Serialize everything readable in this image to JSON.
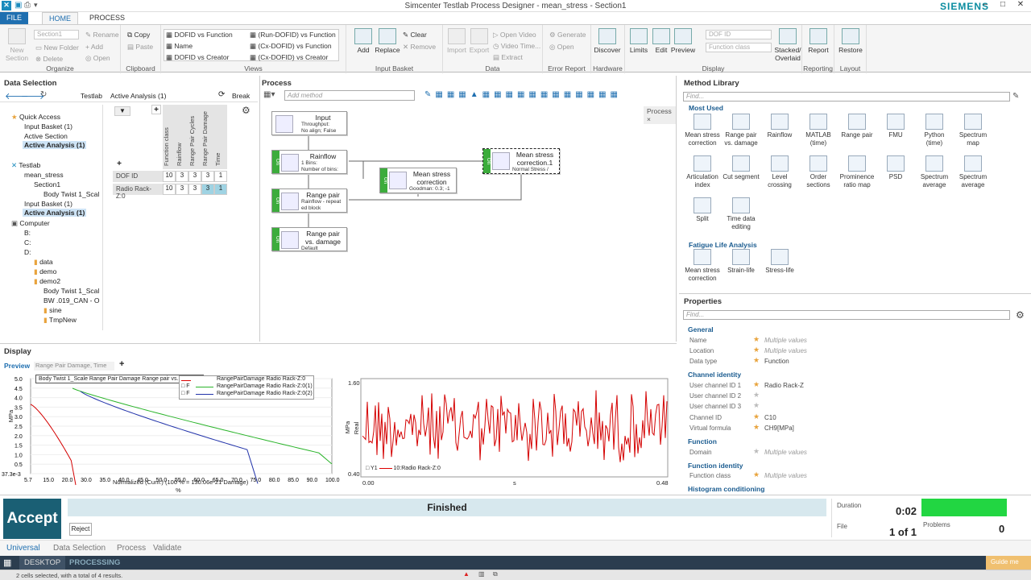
{
  "app": {
    "title": "Simcenter Testlab Process Designer - mean_stress - Section1",
    "brand": "SIEMENS"
  },
  "ribbon_tabs": [
    "FILE",
    "HOME",
    "PROCESS"
  ],
  "ribbon": {
    "organize": {
      "label": "Organize",
      "new_section": "New Section",
      "section_select": "Section1",
      "rename": "Rename",
      "new_folder": "New Folder",
      "delete": "Delete",
      "add": "Add",
      "open": "Open"
    },
    "clipboard": {
      "label": "Clipboard",
      "copy": "Copy",
      "paste": "Paste"
    },
    "views": {
      "label": "Views",
      "left": [
        "DOFID vs Function",
        "Name",
        "DOFID vs Creator"
      ],
      "right": [
        "(Run-DOFID) vs Function",
        "(Cx-DOFID) vs Function",
        "(Cx-DOFID) vs Creator"
      ]
    },
    "input_basket": {
      "label": "Input Basket",
      "add": "Add",
      "replace": "Replace",
      "clear": "Clear",
      "remove": "Remove"
    },
    "data": {
      "label": "Data",
      "import": "Import",
      "export": "Export",
      "open_video": "Open Video",
      "video_time": "Video Time...",
      "extract": "Extract"
    },
    "error_report": {
      "label": "Error Report",
      "generate": "Generate",
      "open": "Open"
    },
    "hardware": {
      "label": "Hardware",
      "discover": "Discover"
    },
    "display": {
      "label": "Display",
      "limits": "Limits",
      "edit": "Edit",
      "preview": "Preview",
      "dof_id": "DOF ID",
      "function_class": "Function class",
      "stacked": "Stacked/ Overlaid"
    },
    "reporting": {
      "label": "Reporting",
      "report": "Report"
    },
    "layout": {
      "label": "Layout",
      "restore": "Restore"
    }
  },
  "data_selection": {
    "title": "Data Selection",
    "breadcrumb": [
      "Testlab",
      "Active Analysis (1)"
    ],
    "break_label": "Break",
    "tree": [
      "Quick Access",
      "Input Basket (1)",
      "Active Section",
      "Active Analysis (1)",
      "Testlab",
      "mean_stress",
      "Section1",
      "Body Twist 1_Scal",
      "Input Basket (1)",
      "Active Analysis (1)",
      "Computer",
      "B:",
      "C:",
      "D:",
      "data",
      "demo",
      "demo2",
      "Body Twist 1_Scal",
      "BW .019_CAN - O",
      "sine",
      "TmpNew"
    ],
    "columns": [
      "Function class",
      "Rainflow",
      "Range Pair Cycles",
      "Range Pair Damage",
      "Time"
    ],
    "rows": [
      {
        "label": "DOF ID",
        "values": [
          "10",
          "3",
          "3",
          "3",
          "1"
        ]
      },
      {
        "label": "Radio Rack-Z:0",
        "values": [
          "10",
          "3",
          "3",
          "3",
          "1"
        ]
      }
    ]
  },
  "process": {
    "title": "Process",
    "add_method_placeholder": "Add method",
    "tab": "Process",
    "nodes": {
      "input": {
        "title": "Input",
        "sub": [
          "Throughput:",
          "No align; False"
        ]
      },
      "rainflow": {
        "title": "Rainflow",
        "sub": [
          "1 Bins:",
          "Number of bins:"
        ]
      },
      "mean": {
        "title": "Mean stress correction",
        "sub": [
          "Goodman: 0.3; -1"
        ]
      },
      "mean1": {
        "title": "Mean stress correction.1",
        "sub": [
          "Normal Stress /"
        ]
      },
      "rangepair": {
        "title": "Range pair",
        "sub": [
          "Rainflow - repeat",
          "ed block"
        ]
      },
      "rpd": {
        "title": "Range pair vs. damage",
        "sub": [
          "Default"
        ]
      }
    }
  },
  "method_library": {
    "title": "Method Library",
    "find_placeholder": "Find...",
    "most_used_label": "Most Used",
    "most_used": [
      "Mean stress correction",
      "Range pair vs. damage",
      "Rainflow",
      "MATLAB (time)",
      "Range pair",
      "FMU",
      "Python (time)",
      "Spectrum map",
      "Articulation index",
      "Cut segment",
      "Level crossing",
      "Order sections",
      "Prominence ratio map",
      "PSD",
      "Spectrum average",
      "Spectrum average",
      "Split",
      "Time data editing"
    ],
    "fatigue_label": "Fatigue Life Analysis",
    "fatigue": [
      "Mean stress correction",
      "Strain-life",
      "Stress-life"
    ]
  },
  "properties": {
    "title": "Properties",
    "find_placeholder": "Find...",
    "general": {
      "label": "General",
      "name_label": "Name",
      "name_val": "Multiple values",
      "location_label": "Location",
      "location_val": "Multiple values",
      "dtype_label": "Data type",
      "dtype_val": "Function"
    },
    "channel": {
      "label": "Channel identity",
      "uc1_label": "User channel ID 1",
      "uc1_val": "Radio Rack-Z",
      "uc2_label": "User channel ID 2",
      "uc3_label": "User channel ID 3",
      "cid_label": "Channel ID",
      "cid_val": "C10",
      "vf_label": "Virtual formula",
      "vf_val": "CH9[MPa]"
    },
    "function": {
      "label": "Function",
      "domain_label": "Domain",
      "domain_val": "Multiple values"
    },
    "function_identity": {
      "label": "Function identity",
      "fc_label": "Function class",
      "fc_val": "Multiple values"
    },
    "histogram_label": "Histogram conditioning"
  },
  "display": {
    "title": "Display",
    "preview_tab": "Preview",
    "dropdown": "Range Pair Damage, Time",
    "left_tooltip": "Body Twist 1_Scale  Range Pair Damage  Range pair vs. damage",
    "left_legend": [
      "RangePairDamage Radio Rack-Z:0",
      "RangePairDamage Radio Rack-Z:0(1)",
      "RangePairDamage Radio Rack-Z:0(2)"
    ],
    "left_legend_marks": [
      "F",
      "F"
    ],
    "left_ylabel": "MPa",
    "left_yticks": [
      "5.0",
      "4.5",
      "4.0",
      "3.5",
      "3.0",
      "2.5",
      "2.0",
      "1.5",
      "1.0",
      "0.5",
      "37.3e-3"
    ],
    "left_xticks": [
      "5.7",
      "15.0",
      "20.0",
      "30.0",
      "35.0",
      "40.0",
      "45.0",
      "50.0",
      "55.0",
      "60.0",
      "65.0",
      "70.0",
      "75.0",
      "80.0",
      "85.0",
      "90.0",
      "100.0"
    ],
    "left_xlabel": "Normalized (Cum.) (100 % = 130.06e-21 Damage)",
    "left_xunit": "%",
    "right_ytop": "1.60",
    "right_ybottom": "0.40",
    "right_ylabel": "MPa",
    "right_ylabel2": "Real",
    "right_xstart": "0.00",
    "right_xend": "0.48",
    "right_xunit": "s",
    "right_legend": "10:Radio Rack-Z:0",
    "right_legend_tag": "Y1"
  },
  "footer": {
    "accept": "Accept",
    "reject": "Reject",
    "status": "Finished",
    "duration_label": "Duration",
    "duration": "0:02",
    "file_label": "File",
    "file": "1 of 1",
    "problems_label": "Problems",
    "problems": "0",
    "tabs": [
      "Universal",
      "Data Selection",
      "Process",
      "Validate"
    ],
    "desktop": "DESKTOP",
    "processing": "PROCESSING",
    "guide": "Guide me",
    "status_text": "2 cells selected, with a total of 4 results."
  },
  "colors": {
    "accent": "#0a8ca0",
    "accept_bg": "#1a5f74",
    "progress": "#22d642",
    "ribbon_tab": "#1f6fb0"
  }
}
